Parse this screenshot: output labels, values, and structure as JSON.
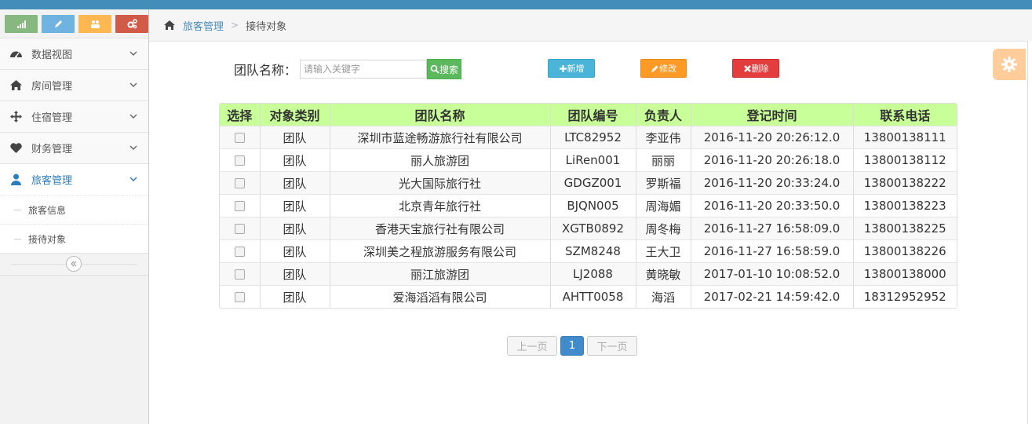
{
  "colors": {
    "topbar": "#438eb9",
    "shortcut_green": "#87b87f",
    "shortcut_blue": "#6fb3e0",
    "shortcut_orange": "#ffb752",
    "shortcut_red": "#d15b47",
    "table_header": "#c8ff98"
  },
  "sidebar": {
    "shortcuts": [
      {
        "icon": "signal-icon"
      },
      {
        "icon": "pencil-icon"
      },
      {
        "icon": "users-icon"
      },
      {
        "icon": "cogs-icon"
      }
    ],
    "items": [
      {
        "label": "数据视图",
        "icon": "dashboard-icon"
      },
      {
        "label": "房间管理",
        "icon": "home-icon"
      },
      {
        "label": "住宿管理",
        "icon": "move-icon"
      },
      {
        "label": "财务管理",
        "icon": "heart-icon"
      },
      {
        "label": "旅客管理",
        "icon": "user-icon"
      }
    ],
    "sub_items": [
      {
        "label": "旅客信息"
      },
      {
        "label": "接待对象"
      }
    ]
  },
  "breadcrumb": {
    "parent": "旅客管理",
    "current": "接待对象"
  },
  "search": {
    "label": "团队名称：",
    "placeholder": "请输入关键字",
    "button": "搜索"
  },
  "actions": {
    "add": "新增",
    "edit": "修改",
    "delete": "删除"
  },
  "table": {
    "headers": [
      "选择",
      "对象类别",
      "团队名称",
      "团队编号",
      "负责人",
      "登记时间",
      "联系电话"
    ],
    "rows": [
      {
        "type": "团队",
        "name": "深圳市蓝途畅游旅行社有限公司",
        "code": "LTC82952",
        "leader": "李亚伟",
        "time": "2016-11-20 20:26:12.0",
        "phone": "13800138111"
      },
      {
        "type": "团队",
        "name": "丽人旅游团",
        "code": "LiRen001",
        "leader": "丽丽",
        "time": "2016-11-20 20:26:18.0",
        "phone": "13800138112"
      },
      {
        "type": "团队",
        "name": "光大国际旅行社",
        "code": "GDGZ001",
        "leader": "罗斯福",
        "time": "2016-11-20 20:33:24.0",
        "phone": "13800138222"
      },
      {
        "type": "团队",
        "name": "北京青年旅行社",
        "code": "BJQN005",
        "leader": "周海媚",
        "time": "2016-11-20 20:33:50.0",
        "phone": "13800138223"
      },
      {
        "type": "团队",
        "name": "香港天宝旅行社有限公司",
        "code": "XGTB0892",
        "leader": "周冬梅",
        "time": "2016-11-27 16:58:09.0",
        "phone": "13800138225"
      },
      {
        "type": "团队",
        "name": "深圳美之程旅游服务有限公司",
        "code": "SZM8248",
        "leader": "王大卫",
        "time": "2016-11-27 16:58:59.0",
        "phone": "13800138226"
      },
      {
        "type": "团队",
        "name": "丽江旅游团",
        "code": "LJ2088",
        "leader": "黄晓敏",
        "time": "2017-01-10 10:08:52.0",
        "phone": "13800138000"
      },
      {
        "type": "团队",
        "name": "爱海滔滔有限公司",
        "code": "AHTT0058",
        "leader": "海滔",
        "time": "2017-02-21 14:59:42.0",
        "phone": "18312952952"
      }
    ]
  },
  "pagination": {
    "prev": "上一页",
    "current": "1",
    "next": "下一页"
  }
}
